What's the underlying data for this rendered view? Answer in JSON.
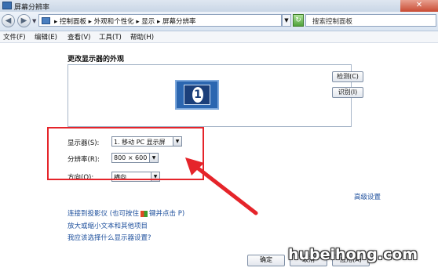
{
  "window": {
    "title": "屏幕分辨率",
    "close_glyph": "✕"
  },
  "nav": {
    "back_glyph": "◀",
    "forward_glyph": "▶",
    "dropdown_glyph": "▼",
    "breadcrumb": "▸ 控制面板 ▸ 外观和个性化 ▸ 显示 ▸ 屏幕分辨率",
    "refresh_glyph": "↻",
    "search_placeholder": "搜索控制面板"
  },
  "menu": [
    {
      "label": "文件(F)"
    },
    {
      "label": "编辑(E)"
    },
    {
      "label": "查看(V)"
    },
    {
      "label": "工具(T)"
    },
    {
      "label": "帮助(H)"
    }
  ],
  "content": {
    "section_title": "更改显示器的外观",
    "monitor_number": "1",
    "detect_label": "检测(C)",
    "identify_label": "识别(I)",
    "display_label": "显示器(S):",
    "display_value": "1. 移动 PC 显示屏",
    "resolution_label": "分辨率(R):",
    "resolution_value": "800 × 600",
    "orientation_label": "方向(O):",
    "orientation_value": "横向",
    "advanced_link": "高级设置",
    "link_projector_a": "连接到投影仪 (也可按住",
    "link_projector_b": "键并点击 P)",
    "link_text_size": "放大或缩小文本和其他项目",
    "link_which_settings": "我应该选择什么显示器设置?",
    "ok_label": "确定",
    "cancel_label": "取消",
    "apply_label": "应用(A)"
  },
  "watermark": "hubeihong.com",
  "colors": {
    "highlight": "#e5242a",
    "link": "#1d4f9c"
  }
}
